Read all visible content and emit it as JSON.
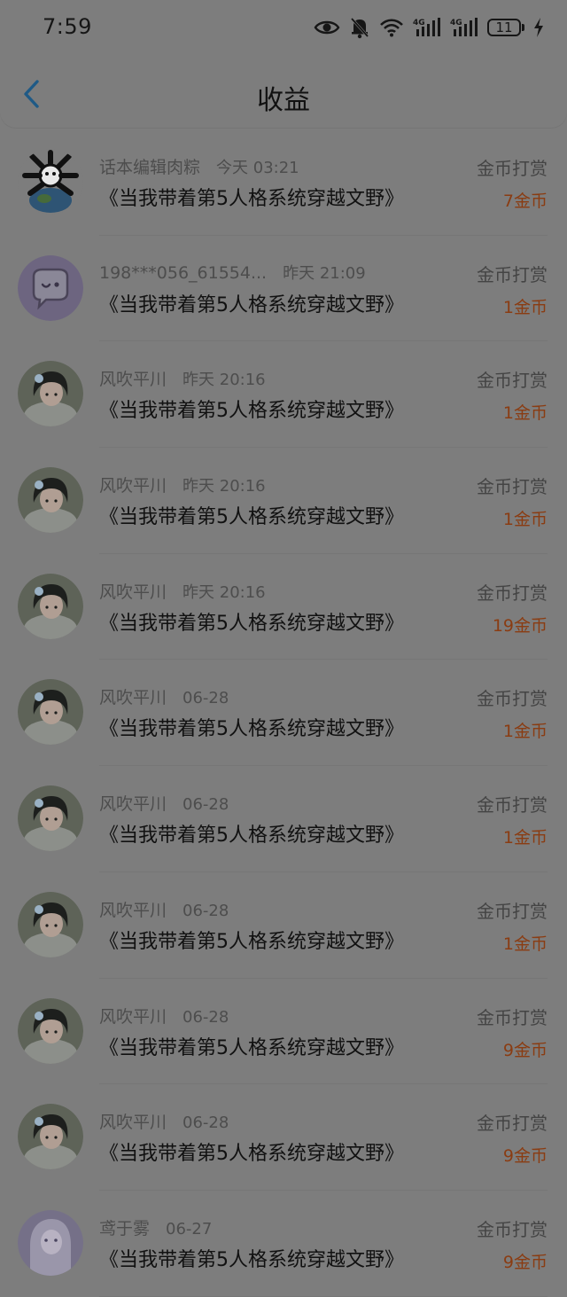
{
  "status_bar": {
    "time": "7:59",
    "battery": "11",
    "icons": [
      "eye-icon",
      "mute-bell-icon",
      "wifi-icon",
      "signal-4g-icon",
      "signal-4g-icon",
      "battery-icon",
      "charging-bolt-icon"
    ]
  },
  "header": {
    "title": "收益",
    "back_icon": "chevron-left-icon"
  },
  "colors": {
    "background": "#7d7d7d",
    "amount": "#8a3c12",
    "back_arrow": "#1f5a86"
  },
  "items": [
    {
      "name": "话本编辑肉粽",
      "time": "今天 03:21",
      "book": "《当我带着第5人格系统穿越文野》",
      "type": "金币打赏",
      "amount": "7金币",
      "avatar": "doodle"
    },
    {
      "name": "198***056_61554...",
      "time": "昨天 21:09",
      "book": "《当我带着第5人格系统穿越文野》",
      "type": "金币打赏",
      "amount": "1金币",
      "avatar": "chat"
    },
    {
      "name": "风吹平川",
      "time": "昨天 20:16",
      "book": "《当我带着第5人格系统穿越文野》",
      "type": "金币打赏",
      "amount": "1金币",
      "avatar": "girl"
    },
    {
      "name": "风吹平川",
      "time": "昨天 20:16",
      "book": "《当我带着第5人格系统穿越文野》",
      "type": "金币打赏",
      "amount": "1金币",
      "avatar": "girl"
    },
    {
      "name": "风吹平川",
      "time": "昨天 20:16",
      "book": "《当我带着第5人格系统穿越文野》",
      "type": "金币打赏",
      "amount": "19金币",
      "avatar": "girl"
    },
    {
      "name": "风吹平川",
      "time": "06-28",
      "book": "《当我带着第5人格系统穿越文野》",
      "type": "金币打赏",
      "amount": "1金币",
      "avatar": "girl"
    },
    {
      "name": "风吹平川",
      "time": "06-28",
      "book": "《当我带着第5人格系统穿越文野》",
      "type": "金币打赏",
      "amount": "1金币",
      "avatar": "girl"
    },
    {
      "name": "风吹平川",
      "time": "06-28",
      "book": "《当我带着第5人格系统穿越文野》",
      "type": "金币打赏",
      "amount": "1金币",
      "avatar": "girl"
    },
    {
      "name": "风吹平川",
      "time": "06-28",
      "book": "《当我带着第5人格系统穿越文野》",
      "type": "金币打赏",
      "amount": "9金币",
      "avatar": "girl"
    },
    {
      "name": "风吹平川",
      "time": "06-28",
      "book": "《当我带着第5人格系统穿越文野》",
      "type": "金币打赏",
      "amount": "9金币",
      "avatar": "girl"
    },
    {
      "name": "鸢于雾",
      "time": "06-27",
      "book": "《当我带着第5人格系统穿越文野》",
      "type": "金币打赏",
      "amount": "9金币",
      "avatar": "lilac"
    }
  ]
}
